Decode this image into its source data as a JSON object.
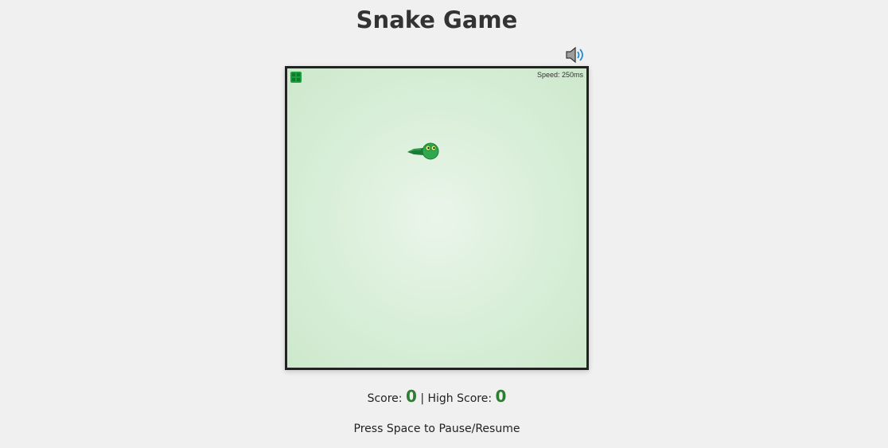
{
  "title": "Snake Game",
  "board": {
    "speed_label": "Speed: 250ms"
  },
  "score": {
    "label": "Score:",
    "value": "0",
    "separator": "|",
    "high_label": "High Score:",
    "high_value": "0"
  },
  "hint": "Press Space to Pause/Resume",
  "icons": {
    "sound": "speaker-icon",
    "food": "food-icon",
    "snake": "snake-head-icon"
  },
  "colors": {
    "background": "#f0f0f0",
    "board_border": "#222222",
    "board_fill": "#d8eed8",
    "snake": "#2fa84f",
    "score_value": "#2e7d32"
  }
}
